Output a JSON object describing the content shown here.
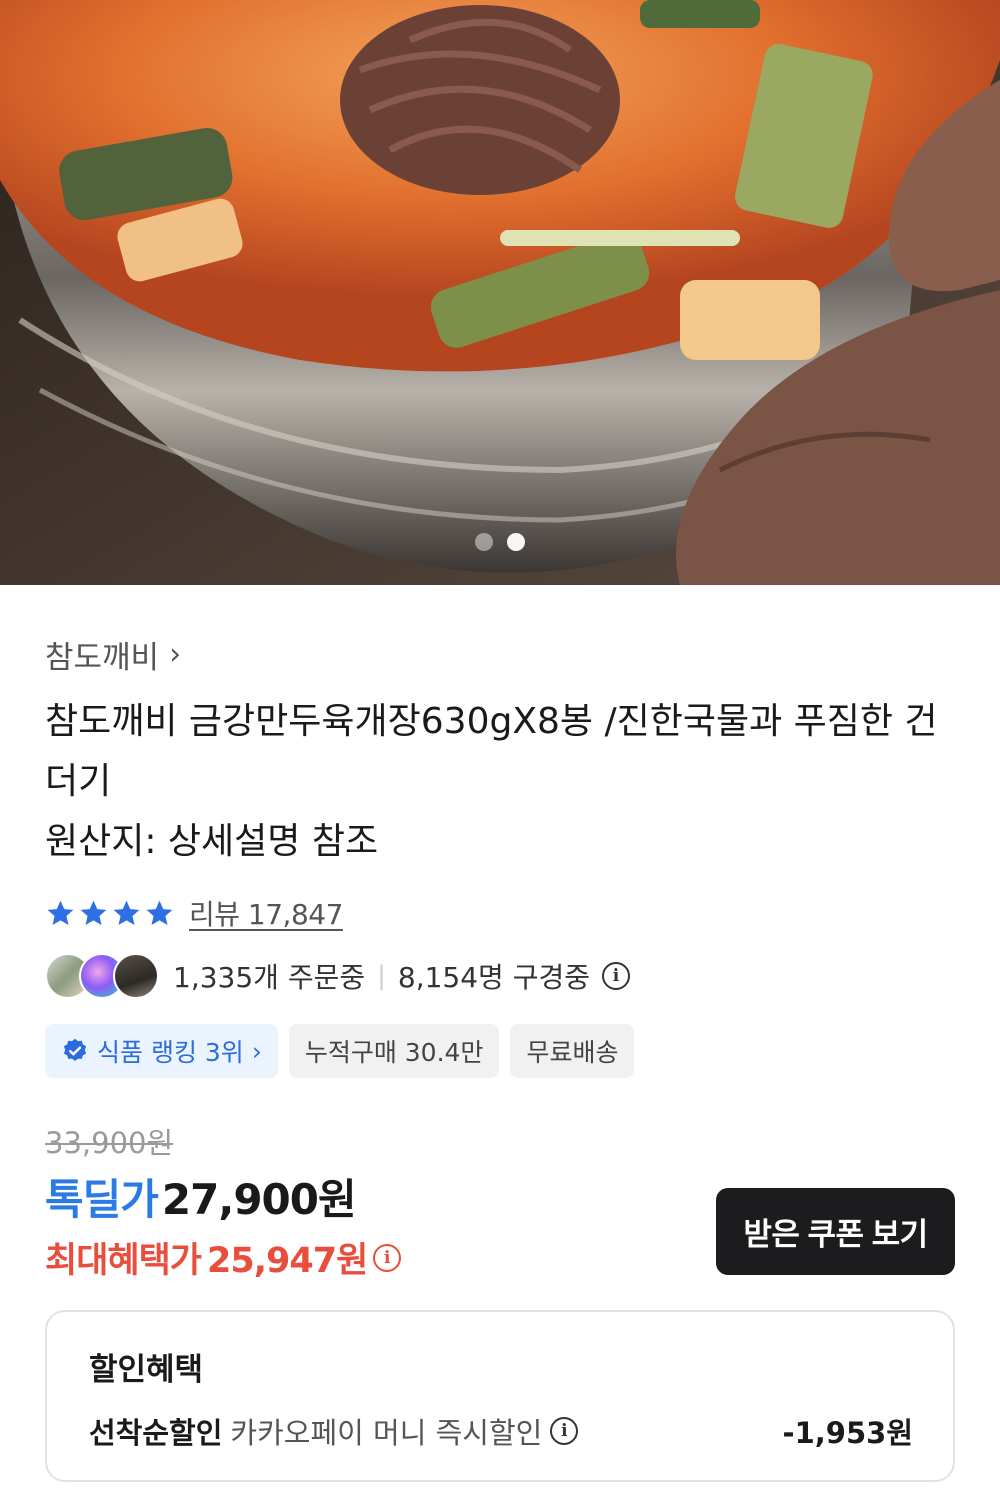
{
  "product": {
    "brand": "참도깨비",
    "title": "참도깨비 금강만두육개장630gX8봉 /진한국물과 푸짐한 건더기",
    "origin": "원산지: 상세설명 참조",
    "review_label": "리뷰 17,847",
    "rating_stars": 4,
    "orders_now": "1,335개 주문중",
    "viewers_now": "8,154명 구경중"
  },
  "gallery": {
    "image_count": 2,
    "active_index": 1
  },
  "chips": [
    {
      "label": "식품 랭킹 3위",
      "icon": "badge-check-icon"
    },
    {
      "label": "누적구매 30.4만"
    },
    {
      "label": "무료배송"
    }
  ],
  "price": {
    "original": "33,900원",
    "deal_label": "톡딜가",
    "deal_price": "27,900원",
    "max_label": "최대혜택가",
    "max_price": "25,947원",
    "coupon_button": "받은 쿠폰 보기"
  },
  "benefits": {
    "title": "할인혜택",
    "items": [
      {
        "name": "선착순할인",
        "desc": "카카오페이 머니 즉시할인",
        "amount": "-1,953원"
      }
    ]
  },
  "colors": {
    "accent_blue": "#2c7be5",
    "accent_red": "#e94e3c",
    "button_dark": "#1c1c1e",
    "star_blue": "#2f6fe4"
  }
}
